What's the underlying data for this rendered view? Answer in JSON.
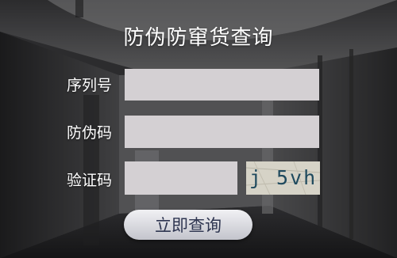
{
  "title": "防伪防窜货查询",
  "form": {
    "serial": {
      "label": "序列号",
      "value": "",
      "placeholder": ""
    },
    "anticode": {
      "label": "防伪码",
      "value": "",
      "placeholder": ""
    },
    "verify": {
      "label": "验证码",
      "value": "",
      "placeholder": ""
    }
  },
  "captcha": {
    "text": "j 5vh"
  },
  "submit_label": "立即查询",
  "colors": {
    "field_bg": "#d4d0d3",
    "button_text": "#2e3550",
    "captcha_text": "#1f4a5e"
  }
}
